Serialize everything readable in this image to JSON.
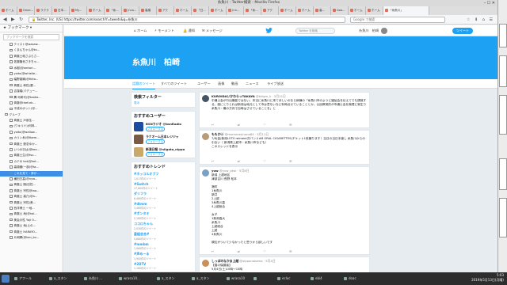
{
  "window": {
    "title": "糸魚川 - Twitter検索 - Mozilla Firefox"
  },
  "tabs": [
    "ホーム",
    "Gmai...",
    "ラクラ",
    "日本...",
    "My...",
    "ホーム",
    "「糸...",
    "(nca...",
    "高橋",
    "アク",
    "ホーム",
    "「日...",
    "ホーム",
    "(nn...",
    "「糸...",
    "アク",
    "ホーム",
    "ホーム",
    "高...",
    "Goo...",
    "ホーム",
    "ホーム",
    "「糸魚川」"
  ],
  "navbar": {
    "url": "https://twitter.com/search?f=tweets&q=糸魚川",
    "url_site": "Twitter, Inc. (US)",
    "search_placeholder": "Google で検索"
  },
  "sidebar": {
    "header": "ブックマーク",
    "search_placeholder": "ブックマークを検索",
    "items": [
      {
        "label": "テイスト@wasaw...",
        "folder": false
      },
      {
        "label": "くまんちゃん@ks...",
        "folder": false
      },
      {
        "label": "斉藤土岐さぷらさ...",
        "folder": false
      },
      {
        "label": "佐藤隆世さきちゃ...",
        "folder": false
      },
      {
        "label": "水樹(@amtari...",
        "folder": false
      },
      {
        "label": "yoito(@whistle...",
        "folder": false
      },
      {
        "label": "幅野香織(@tkito...",
        "folder": false
      },
      {
        "label": "斉藤土 和性(選...",
        "folder": false
      },
      {
        "label": "吉窪堰(パデュー...",
        "folder": false
      },
      {
        "label": "鷹 司希代(@taaka...",
        "folder": false
      },
      {
        "label": "斉藤@thefurk...",
        "folder": false
      },
      {
        "label": "平成のボット(@...",
        "folder": false
      },
      {
        "label": "グループ",
        "folder": true
      },
      {
        "label": "斉藤土 戸部生...",
        "folder": false
      },
      {
        "label": "(ワキリド)(何林...",
        "folder": false
      },
      {
        "label": "yoito(@wallow...",
        "folder": false
      },
      {
        "label": "カリン糸(@tbem...",
        "folder": false
      },
      {
        "label": "斉藤土 懸念ゆか...",
        "folder": false
      },
      {
        "label": "いつの日は(@kez...",
        "folder": false
      },
      {
        "label": "斉藤土生(@tsu...",
        "folder": false
      },
      {
        "label": "カテの kot(@kot...",
        "folder": false
      },
      {
        "label": "高橋徹(一部(@ta...",
        "folder": false
      },
      {
        "label": "これを見て・夢が...",
        "folder": false,
        "selected": true
      },
      {
        "label": "横田古高(@nyw...",
        "folder": false
      },
      {
        "label": "斉藤土 隠(旧性...",
        "folder": false
      },
      {
        "label": "斉藤土 宗性@taa...",
        "folder": false
      },
      {
        "label": "斉藤土 高乃(@a...",
        "folder": false
      },
      {
        "label": "斉藤土 宗性(美...",
        "folder": false
      },
      {
        "label": "西洋博士 一地...",
        "folder": false
      },
      {
        "label": "斉藤土 地(@kal...",
        "folder": false
      },
      {
        "label": "美会示性 Yoji O...",
        "folder": false
      },
      {
        "label": "斉藤土 地(土の...",
        "folder": false
      },
      {
        "label": "斉藤土 HARAYO...",
        "folder": false
      },
      {
        "label": "片岡輝(@ken_ko...",
        "folder": false
      }
    ]
  },
  "twitter": {
    "topnav": {
      "home": "ホーム",
      "moments": "モーメント",
      "notifications": "通知",
      "messages": "メッセージ"
    },
    "search_placeholder": "Twitter を検索",
    "user_short": "糸魚川　柏崎",
    "tweet_button": "ツイート",
    "banner_title": "糸魚川　柏崎",
    "tabs": [
      "話題のツイート",
      "すべてのツイート",
      "ユーザー",
      "画像",
      "動画",
      "ニュース",
      "ライブ放送"
    ],
    "follow_label": "フォローする",
    "filter_card": {
      "title": "検索フィルター",
      "sub": "表示"
    },
    "who_to_follow": {
      "title": "おすすめユーザー",
      "sub": "更新・すべて見る",
      "users": [
        {
          "name": "BSNラジオ @bsnRadio",
          "color": "#1b4ea0",
          "follow": "フォローする"
        },
        {
          "name": "ラナオーム日本レジジャ",
          "color": "#7a5b45",
          "follow": "フォローする"
        },
        {
          "name": "新潟日報 @niigata_nippo",
          "color": "#c8a96a",
          "follow": "フォローする"
        }
      ]
    },
    "trends": {
      "title": "おすすめトレンド",
      "sub": "変更",
      "items": [
        {
          "name": "#ホッコルオブフ",
          "count": "1,017件のツイート"
        },
        {
          "name": "#Switch",
          "count": "17,600件のツイート"
        },
        {
          "name": "ダリフラ",
          "count": "8,460件のツイート"
        },
        {
          "name": "#dtmm",
          "count": "3,460件のツイート"
        },
        {
          "name": "#ポンタキ",
          "count": "2,180件のツイート"
        },
        {
          "name": "ココロちゃん",
          "count": "2,030件のツイート"
        },
        {
          "name": "星組会合#",
          "count": "5,680件のツイート"
        },
        {
          "name": "#mmbm",
          "count": "1,960件のツイート"
        },
        {
          "name": "#声めーる",
          "count": "1,900件のツイート"
        },
        {
          "name": "#2DTV",
          "count": "1,180件のツイート"
        }
      ]
    },
    "tweets": [
      {
        "name": "KUROIDAいかわらっTAKAYA",
        "handle": "@kklgm_k · 5月11日",
        "color": "#445566",
        "body": "中通士会が行出機能ではない。本当に糸魚川に来てほしいのなら病棟の「糸魚川市のように福祉会を伝えてでも誘致する。誰にとりとれば新潟は地元として市は意ないなど利時点せていることとか。公民教育的が市通士会を無理に寂生り糸魚川・最の方向で自時はさせていることを」と",
        "acts": "↩ ⇄ ♡ ✉"
      },
      {
        "name": "ももか🐱",
        "handle": "@momorasinona84 · 5月11日",
        "color": "#b89b77",
        "body": "7/8(金)新潟LOTS reiment共バンド#8 ORAL CIGARETTES(チケット1枚譲ります！当日の当日手渡し 糸魚川からの引合い（ 新潟県上越市・糸魚川市なども）\nこのスレッドを表示",
        "acts": "↩ ⇄ ♡ ✉"
      },
      {
        "name": "yuw",
        "handle": "@yuw_ptwi · 5月8日",
        "color": "#7aa0c4",
        "body": "新潟 上越地区\n津部吉川 長野 松本\n\n港町\n1糸魚川\n新井\n2上越\n3糸魚川高\n4上越総合\n\n女子\n1新潟高大\n糸魚川\n上越総合\n上越\n4糸魚川\n\n順位がついて少なかったと思うから欲しいです",
        "acts": "↩ ⇄ ♡ ✉"
      },
      {
        "name": "しっぽのなかま上越",
        "handle": "@sipponakama · 5月4日",
        "color": "#c9905a",
        "body": "【猫の保護者】\n5月4日(土)10時〜15時",
        "acts": "↩ ⇄ ♡ ✉"
      }
    ]
  },
  "taskbar": {
    "items": [
      "アフール",
      "a_スタン",
      "糸魚川 ...",
      "wrasa10...",
      "a_スタン",
      "a_スタン",
      "wrasa10",
      "",
      "ecloc",
      "ebi4",
      "doac"
    ],
    "time": "5:03",
    "date": "2019年5月13日(月曜)"
  }
}
